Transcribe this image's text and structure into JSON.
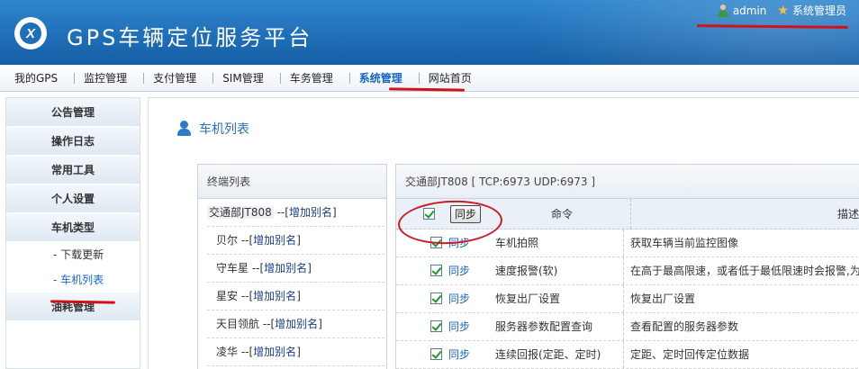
{
  "header": {
    "logo_letter": "X",
    "title": "GPS车辆定位服务平台",
    "user": "admin",
    "role": "系统管理员"
  },
  "nav": {
    "items": [
      "我的GPS",
      "监控管理",
      "支付管理",
      "SIM管理",
      "车务管理",
      "系统管理",
      "网站首页"
    ],
    "active": "系统管理"
  },
  "sidebar": {
    "sections": [
      "公告管理",
      "操作日志",
      "常用工具",
      "个人设置",
      "车机类型",
      "油耗管理"
    ],
    "subitems": [
      "- 下载更新",
      "- 车机列表"
    ],
    "active_sub": "- 车机列表"
  },
  "page": {
    "title": "车机列表"
  },
  "terminal_panel": {
    "header": "终端列表",
    "rows": [
      {
        "name": "交通部JT808",
        "sep": " --[",
        "alias": "增加别名",
        "end": "]"
      },
      {
        "name": "贝尔",
        "sep": " --[",
        "alias": "增加别名",
        "end": "]"
      },
      {
        "name": "守车星",
        "sep": " --[",
        "alias": "增加别名",
        "end": "]"
      },
      {
        "name": "星安",
        "sep": " --[",
        "alias": "增加别名",
        "end": "]"
      },
      {
        "name": "天目领航",
        "sep": " --[",
        "alias": "增加别名",
        "end": "]"
      },
      {
        "name": "凌华",
        "sep": " --[",
        "alias": "增加别名",
        "end": "]"
      }
    ]
  },
  "command_panel": {
    "header": "交通部JT808 [ TCP:6973 UDP:6973 ]",
    "head_sync_button": "同步",
    "col_command": "命令",
    "col_desc": "描述",
    "rows": [
      {
        "sync": "同步",
        "command": "车机拍照",
        "desc": "获取车辆当前监控图像"
      },
      {
        "sync": "同步",
        "command": "速度报警(软)",
        "desc": "在高于最高限速，或者低于最低限速时会报警,为"
      },
      {
        "sync": "同步",
        "command": "恢复出厂设置",
        "desc": "恢复出厂设置"
      },
      {
        "sync": "同步",
        "command": "服务器参数配置查询",
        "desc": "查看配置的服务器参数"
      },
      {
        "sync": "同步",
        "command": "连续回报(定距、定时)",
        "desc": "定距、定时回传定位数据"
      }
    ]
  },
  "colors": {
    "header_blue": "#1f6fb8",
    "accent_blue": "#1466c7",
    "annotation_red": "#cc1b22"
  }
}
